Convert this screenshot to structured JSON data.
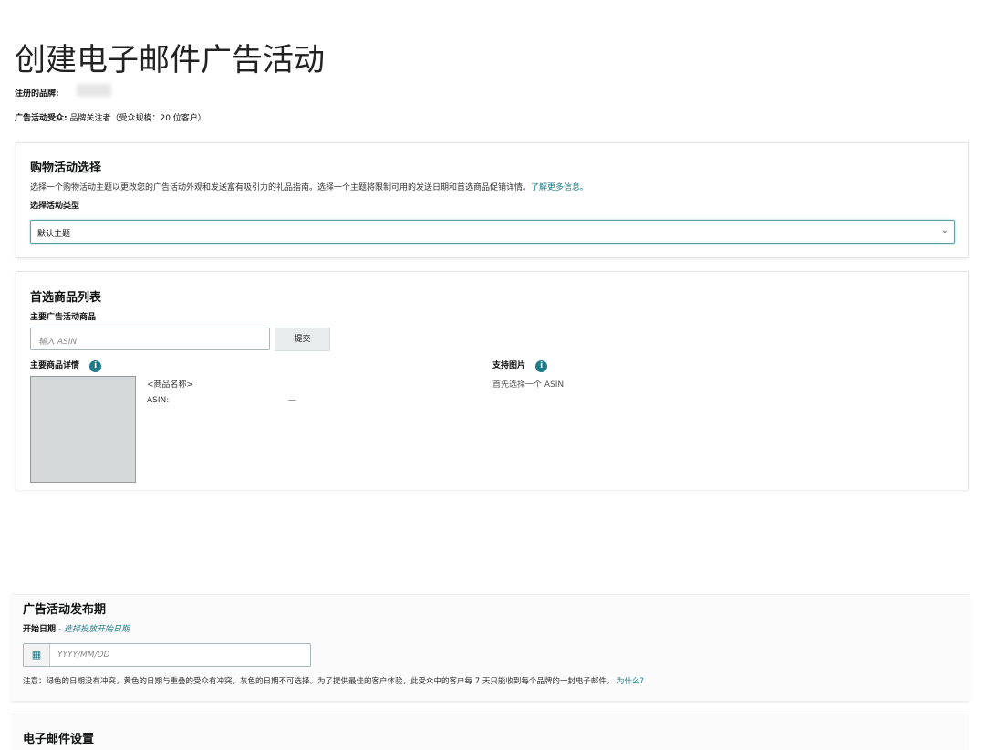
{
  "title": "创建电子邮件广告活动",
  "brand_label": "注册的品牌:",
  "audience_label": "广告活动受众:",
  "audience_value": "品牌关注者（受众规模：20 位客户）",
  "theme": {
    "heading": "购物活动选择",
    "desc": "选择一个购物活动主题以更改您的广告活动外观和发送富有吸引力的礼品指南。选择一个主题将限制可用的发送日期和首选商品促销详情。",
    "learn_more": "了解更多信息。",
    "type_label": "选择活动类型",
    "selected": "默认主题"
  },
  "products": {
    "heading": "首选商品列表",
    "main_label": "主要广告活动商品",
    "asin_placeholder": "输入 ASIN",
    "submit": "提交",
    "details_label": "主要商品详情",
    "product_name": "<商品名称>",
    "asin_label": "ASIN:",
    "asin_value": "—",
    "support_label": "支持图片",
    "support_hint": "首先选择一个 ASIN"
  },
  "schedule": {
    "heading": "广告活动发布期",
    "start_label": "开始日期",
    "start_hint": "- 选择投放开始日期",
    "date_placeholder": "YYYY/MM/DD",
    "note": "注意：绿色的日期没有冲突，黄色的日期与重叠的受众有冲突，灰色的日期不可选择。为了提供最佳的客户体验，此受众中的客户每 7 天只能收到每个品牌的一封电子邮件。",
    "why": "为什么?"
  },
  "email_settings": {
    "heading": "电子邮件设置"
  }
}
